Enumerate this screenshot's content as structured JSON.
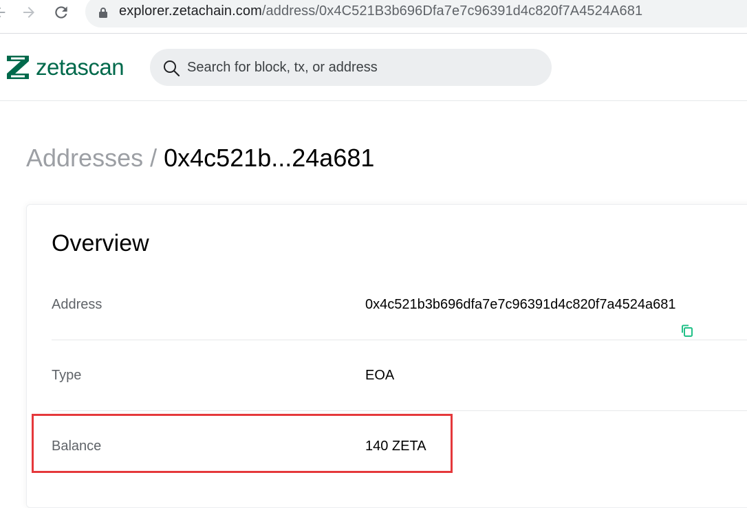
{
  "browser": {
    "url_host": "explorer.zetachain.com",
    "url_path": "/address/0x4C521B3b696Dfa7e7c96391d4c820f7A4524A681"
  },
  "header": {
    "logo_text": "zetascan",
    "search": {
      "placeholder": "Search for block, tx, or address",
      "value": ""
    }
  },
  "breadcrumb": {
    "parent": "Addresses",
    "separator": "/",
    "current": "0x4c521b...24a681"
  },
  "overview": {
    "title": "Overview",
    "rows": [
      {
        "label": "Address",
        "value": "0x4c521b3b696dfa7e7c96391d4c820f7a4524a681"
      },
      {
        "label": "Type",
        "value": "EOA"
      },
      {
        "label": "Balance",
        "value": "140 ZETA"
      }
    ]
  },
  "colors": {
    "brand": "#00694b",
    "copy_icon": "#21c087",
    "highlight": "#e5383b"
  },
  "icons": {
    "back": "back-arrow-icon",
    "forward": "forward-arrow-icon",
    "reload": "reload-icon",
    "lock": "lock-icon",
    "search": "search-icon",
    "copy": "copy-icon",
    "logo": "zeta-logo-icon"
  }
}
